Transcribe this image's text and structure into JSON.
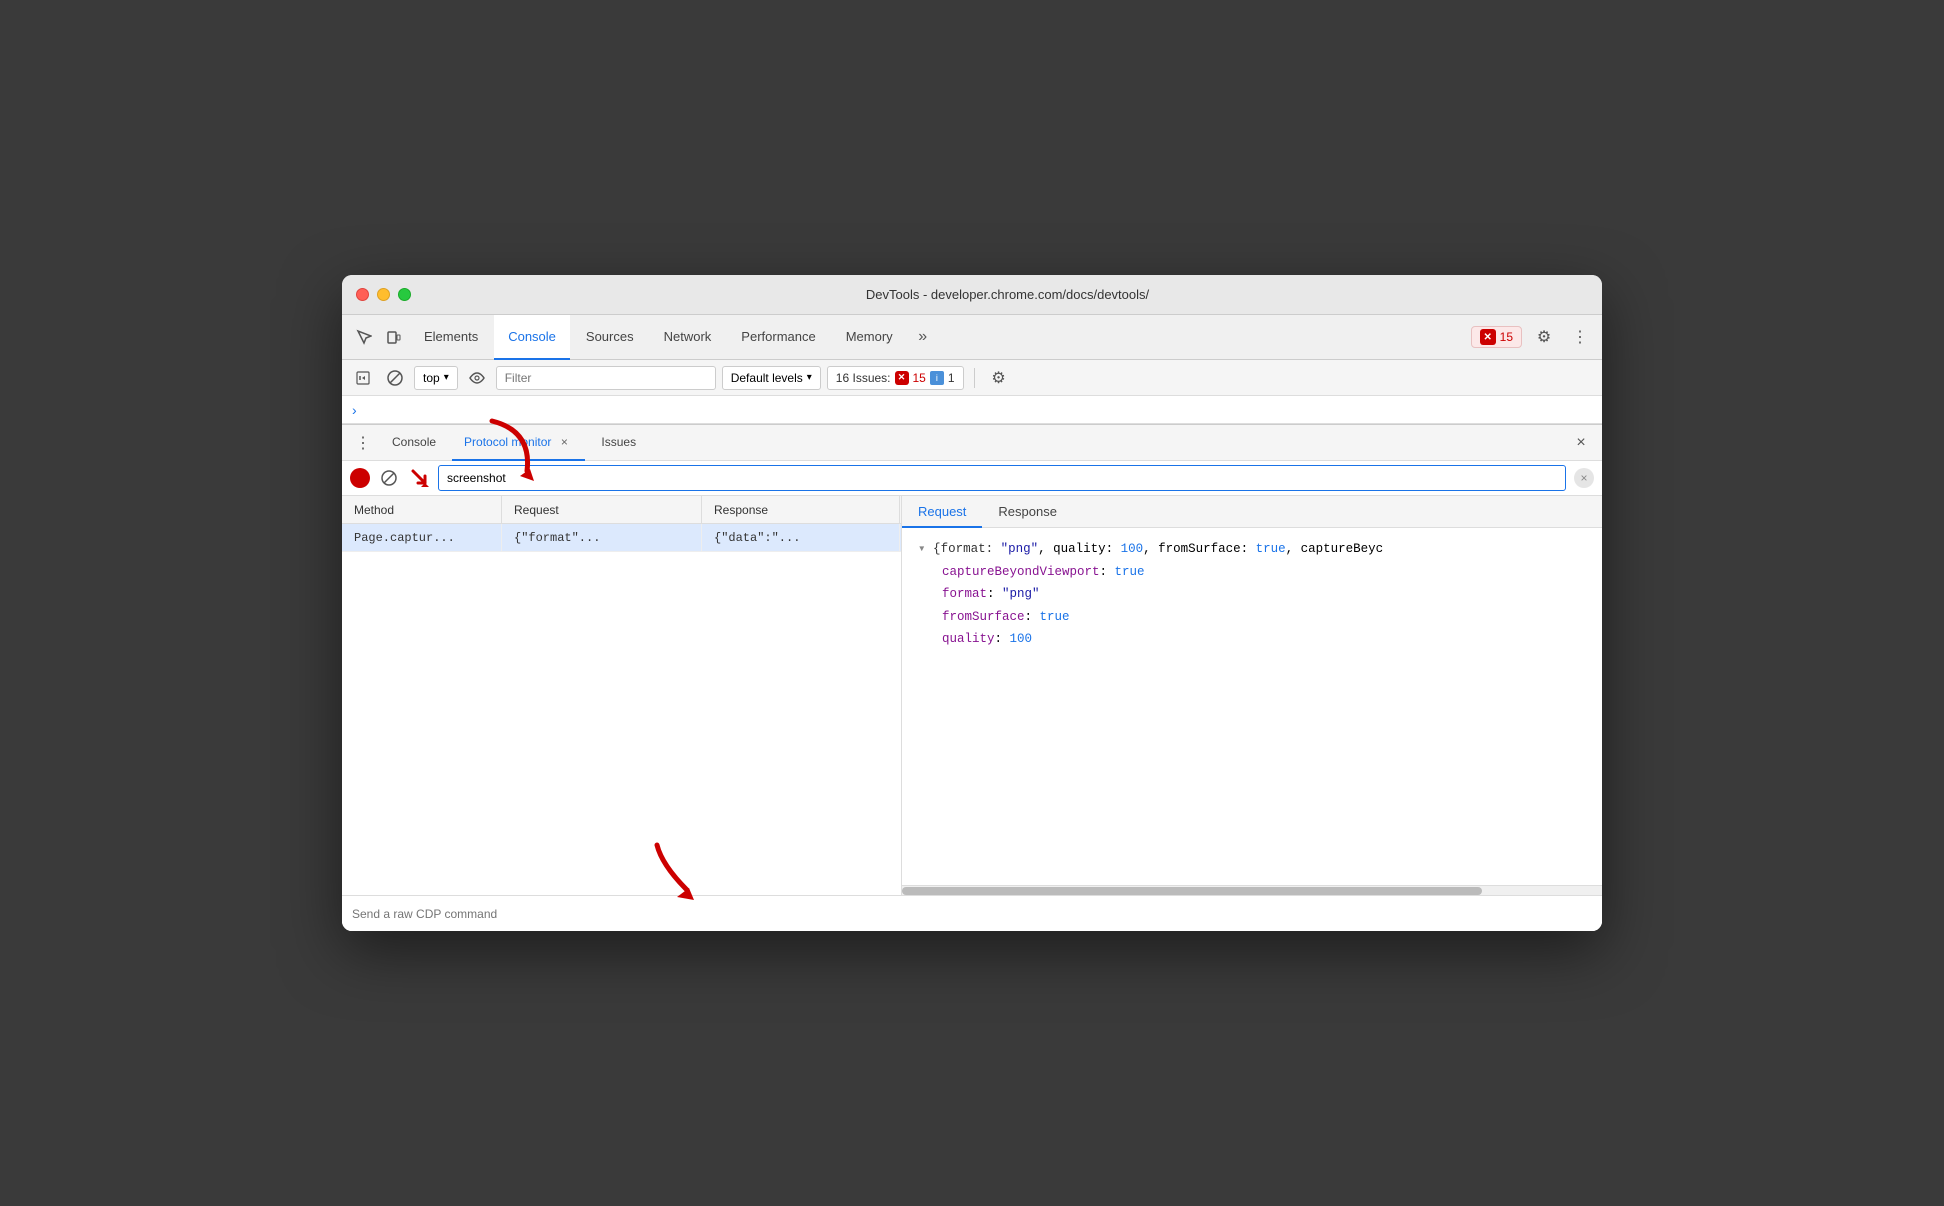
{
  "window": {
    "title": "DevTools - developer.chrome.com/docs/devtools/"
  },
  "tab_bar": {
    "tabs": [
      {
        "id": "elements",
        "label": "Elements",
        "active": false
      },
      {
        "id": "console",
        "label": "Console",
        "active": true
      },
      {
        "id": "sources",
        "label": "Sources",
        "active": false
      },
      {
        "id": "network",
        "label": "Network",
        "active": false
      },
      {
        "id": "performance",
        "label": "Performance",
        "active": false
      },
      {
        "id": "memory",
        "label": "Memory",
        "active": false
      }
    ],
    "more_label": "»",
    "error_count": "15",
    "gear_icon": "⚙",
    "more_icon": "⋮"
  },
  "console_toolbar": {
    "execute_icon": "▷",
    "block_icon": "🚫",
    "context_label": "top",
    "eye_icon": "👁",
    "filter_placeholder": "Filter",
    "default_levels_label": "Default levels",
    "dropdown_icon": "▾",
    "issues_label": "16 Issues:",
    "issues_error_count": "15",
    "issues_info_count": "1",
    "gear_icon": "⚙"
  },
  "breadcrumb": {
    "chevron": "›"
  },
  "drawer": {
    "three_dot_icon": "⋮",
    "tabs": [
      {
        "id": "console",
        "label": "Console",
        "closeable": false
      },
      {
        "id": "protocol_monitor",
        "label": "Protocol monitor",
        "closeable": true,
        "active": true
      },
      {
        "id": "issues",
        "label": "Issues",
        "closeable": false
      }
    ],
    "close_icon": "×"
  },
  "protocol_monitor": {
    "record_btn_title": "Record",
    "clear_btn": "🚫",
    "download_btn": "⬇",
    "search_placeholder": "screenshot",
    "search_clear_icon": "×",
    "table": {
      "headers": [
        "Method",
        "Request",
        "Response"
      ],
      "rows": [
        {
          "method": "Page.captur...",
          "request": "{\"format\"...",
          "response": "{\"data\":\"..."
        }
      ]
    },
    "detail_tabs": [
      {
        "id": "request",
        "label": "Request",
        "active": true
      },
      {
        "id": "response",
        "label": "Response",
        "active": false
      }
    ],
    "detail": {
      "top_line": "{format: \"png\", quality: 100, fromSurface: true, captureBeyc",
      "fields": [
        {
          "key": "captureBeyondViewport",
          "value": "true",
          "value_type": "boolean"
        },
        {
          "key": "format",
          "value": "\"png\"",
          "value_type": "string"
        },
        {
          "key": "fromSurface",
          "value": "true",
          "value_type": "boolean"
        },
        {
          "key": "quality",
          "value": "100",
          "value_type": "number"
        }
      ]
    }
  },
  "bottom_bar": {
    "placeholder": "Send a raw CDP command"
  }
}
